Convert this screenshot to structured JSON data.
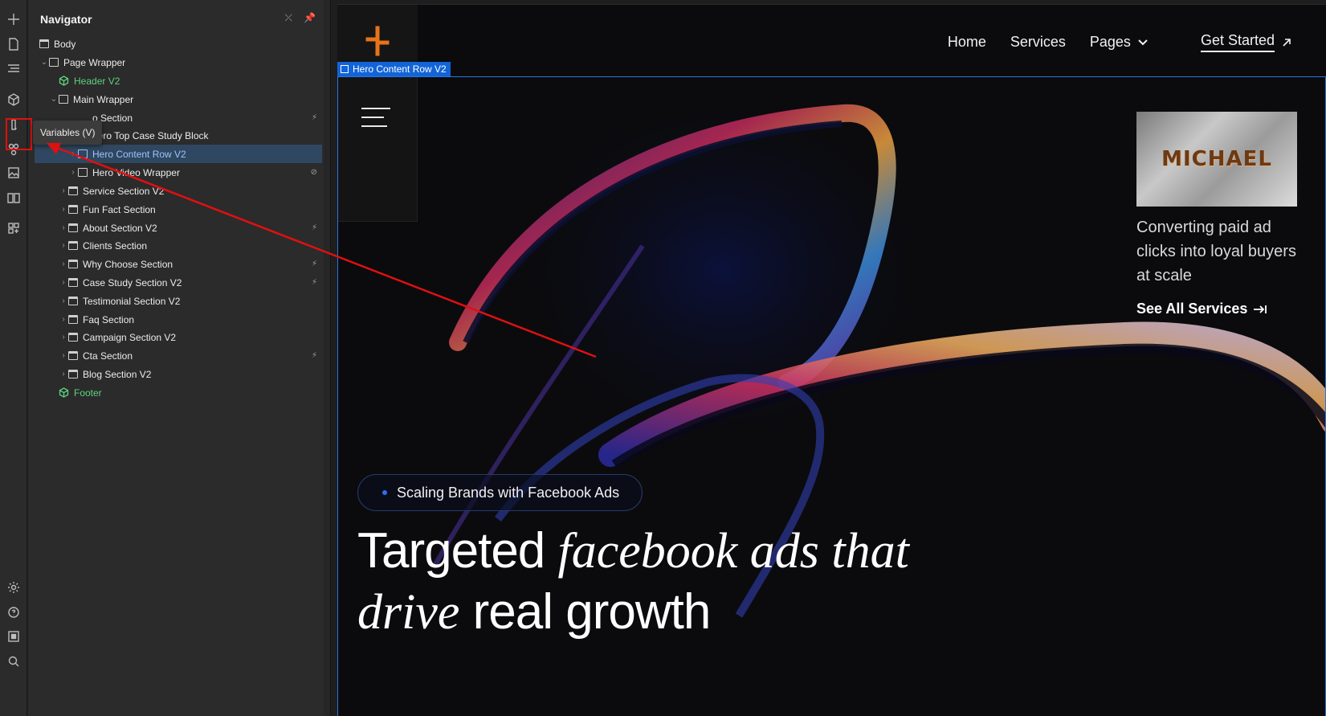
{
  "rail": {
    "tooltip": "Variables (V)"
  },
  "navigator": {
    "title": "Navigator",
    "rows": [
      {
        "label": "Body"
      },
      {
        "label": "Page Wrapper"
      },
      {
        "label": "Header V2"
      },
      {
        "label": "Main Wrapper"
      },
      {
        "label": "o Section"
      },
      {
        "label": "Hero Top Case Study Block"
      },
      {
        "label": "Hero Content Row V2"
      },
      {
        "label": "Hero Video Wrapper"
      },
      {
        "label": "Service Section V2"
      },
      {
        "label": "Fun Fact Section"
      },
      {
        "label": "About Section V2"
      },
      {
        "label": "Clients Section"
      },
      {
        "label": "Why Choose Section"
      },
      {
        "label": "Case Study Section V2"
      },
      {
        "label": "Testimonial Section V2"
      },
      {
        "label": "Faq Section"
      },
      {
        "label": "Campaign Section V2"
      },
      {
        "label": "Cta Section"
      },
      {
        "label": "Blog Section V2"
      },
      {
        "label": "Footer"
      }
    ]
  },
  "site": {
    "nav": {
      "home": "Home",
      "services": "Services",
      "pages": "Pages",
      "cta": "Get Started"
    },
    "selection_tag": "Hero Content Row V2",
    "thumb_text": "MICHAEL",
    "side_copy": "Converting paid ad clicks into loyal buyers at scale",
    "see_all": "See All Services",
    "pill": "Scaling Brands with Facebook Ads",
    "hero": {
      "w1": "Targeted",
      "w2": "facebook ads that",
      "w3": "drive",
      "w4": "real growth"
    }
  },
  "colors": {
    "accent_orange": "#e8731a",
    "selection_blue": "#1264d8",
    "annotation_red": "#e01010",
    "component_green": "#5fd17d"
  }
}
